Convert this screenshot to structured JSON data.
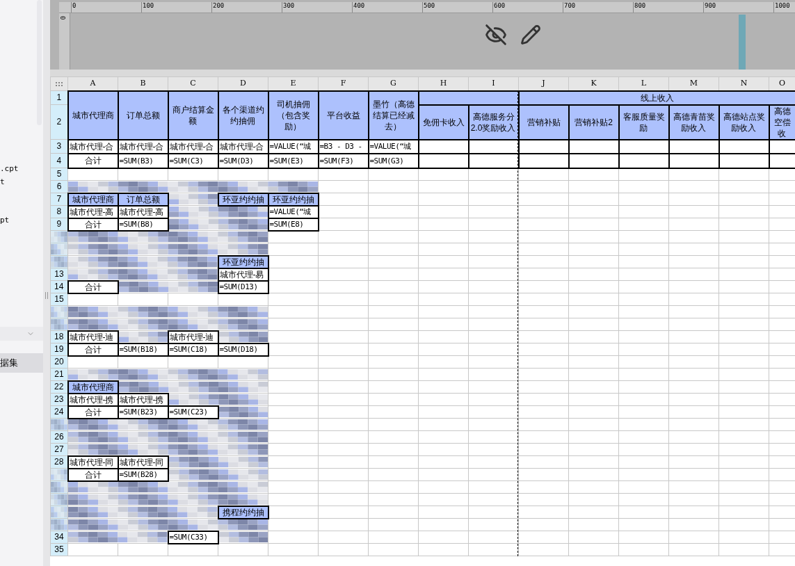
{
  "sidebar": {
    "files": [
      ".cpt",
      "t",
      "pt"
    ],
    "section_tab": "据集"
  },
  "ruler": {
    "top_labels": [
      "0",
      "100",
      "200",
      "300",
      "400",
      "500",
      "600",
      "700",
      "800",
      "900",
      "1000"
    ],
    "left_labels": [
      "0"
    ]
  },
  "columns": [
    "A",
    "B",
    "C",
    "D",
    "E",
    "F",
    "G",
    "H",
    "I",
    "J",
    "K",
    "L",
    "M",
    "N",
    "O"
  ],
  "rows": [
    {
      "number": "1",
      "cells": [
        {
          "kind": "tall-header",
          "text": "城市代理商"
        },
        {
          "kind": "tall-header",
          "text": "订单总额"
        },
        {
          "kind": "tall-header",
          "text": "商户结算金额"
        },
        {
          "kind": "tall-header",
          "text": "各个渠道约约抽佣"
        },
        {
          "kind": "tall-header",
          "text": "司机抽佣（包含奖励）"
        },
        {
          "kind": "tall-header",
          "text": "平台收益"
        },
        {
          "kind": "tall-header",
          "text": "墨竹（高德结算已经减去）"
        },
        {
          "kind": "group-header"
        },
        {
          "kind": "group-header",
          "text": "线上收入"
        }
      ]
    },
    {
      "number": "2",
      "cells": [
        {
          "kind": "header",
          "text": "免佣卡收入"
        },
        {
          "kind": "header",
          "text": "高德服务分2.0奖励收入"
        },
        {
          "kind": "header",
          "text": "营销补贴"
        },
        {
          "kind": "header",
          "text": "营销补贴2"
        },
        {
          "kind": "header",
          "text": "客服质量奖励"
        },
        {
          "kind": "header",
          "text": "高德青苗奖励收入"
        },
        {
          "kind": "header",
          "text": "高德站点奖励收入"
        },
        {
          "kind": "header",
          "text": "高德空偿收"
        }
      ]
    },
    {
      "number": "3",
      "cells": [
        {
          "kind": "data",
          "text": "城市代理-合"
        },
        {
          "kind": "data",
          "text": "城市代理-合"
        },
        {
          "kind": "data",
          "text": "城市代理-合"
        },
        {
          "kind": "data",
          "text": "城市代理-合"
        },
        {
          "kind": "formula",
          "text": "=VALUE(“城"
        },
        {
          "kind": "formula",
          "text": "=B3 - D3 -"
        },
        {
          "kind": "formula",
          "text": "=VALUE(“城"
        },
        {
          "kind": "blank"
        },
        {
          "kind": "blank"
        },
        {
          "kind": "blank"
        },
        {
          "kind": "blank"
        },
        {
          "kind": "blank"
        },
        {
          "kind": "blank"
        },
        {
          "kind": "blank"
        },
        {
          "kind": "blank"
        }
      ]
    },
    {
      "number": "4",
      "cells": [
        {
          "kind": "total",
          "text": "合计"
        },
        {
          "kind": "formula",
          "text": "=SUM(B3)"
        },
        {
          "kind": "formula",
          "text": "=SUM(C3)"
        },
        {
          "kind": "formula",
          "text": "=SUM(D3)"
        },
        {
          "kind": "formula",
          "text": "=SUM(E3)"
        },
        {
          "kind": "formula",
          "text": "=SUM(F3)"
        },
        {
          "kind": "formula",
          "text": "=SUM(G3)"
        },
        {
          "kind": "blank"
        },
        {
          "kind": "blank"
        },
        {
          "kind": "blank"
        },
        {
          "kind": "blank"
        },
        {
          "kind": "blank"
        },
        {
          "kind": "blank"
        },
        {
          "kind": "blank"
        },
        {
          "kind": "blank"
        }
      ]
    },
    {
      "number": "5",
      "cells": []
    },
    {
      "number": "6",
      "cells": [
        {
          "kind": "redacted"
        },
        {
          "kind": "redacted"
        },
        {
          "kind": "redacted"
        },
        {
          "kind": "redacted"
        },
        {
          "kind": "redacted"
        }
      ]
    },
    {
      "number": "7",
      "cells": [
        {
          "kind": "header",
          "text": "城市代理商"
        },
        {
          "kind": "header",
          "text": "订单总额"
        },
        {
          "kind": "redacted"
        },
        {
          "kind": "header",
          "text": "环亚约约抽"
        },
        {
          "kind": "header",
          "text": "环亚约约抽"
        }
      ]
    },
    {
      "number": "8",
      "cells": [
        {
          "kind": "data",
          "text": "城市代理-高"
        },
        {
          "kind": "data",
          "text": "城市代理-高"
        },
        {
          "kind": "redacted"
        },
        {
          "kind": "redacted"
        },
        {
          "kind": "formula",
          "text": "=VALUE(“城"
        }
      ]
    },
    {
      "number": "9",
      "cells": [
        {
          "kind": "total",
          "text": "合计"
        },
        {
          "kind": "formula",
          "text": "=SUM(B8)"
        },
        {
          "kind": "redacted"
        },
        {
          "kind": "redacted"
        },
        {
          "kind": "formula",
          "text": "=SUM(E8)"
        }
      ]
    },
    {
      "cells": [
        {
          "kind": "redacted"
        },
        {
          "kind": "redacted"
        },
        {
          "kind": "redacted"
        },
        {
          "kind": "redacted"
        }
      ]
    },
    {
      "cells": [
        {
          "kind": "redacted"
        },
        {
          "kind": "redacted"
        },
        {
          "kind": "redacted"
        },
        {
          "kind": "redacted"
        }
      ]
    },
    {
      "cells": [
        {
          "kind": "redacted"
        },
        {
          "kind": "redacted"
        },
        {
          "kind": "redacted"
        },
        {
          "kind": "header",
          "text": "环亚约约抽"
        }
      ]
    },
    {
      "number": "13",
      "cells": [
        {
          "kind": "redacted"
        },
        {
          "kind": "redacted"
        },
        {
          "kind": "redacted"
        },
        {
          "kind": "data",
          "text": "城市代理-易"
        }
      ]
    },
    {
      "number": "14",
      "cells": [
        {
          "kind": "total",
          "text": "合计"
        },
        {
          "kind": "redacted"
        },
        {
          "kind": "redacted"
        },
        {
          "kind": "formula",
          "text": "=SUM(D13)"
        }
      ]
    },
    {
      "number": "15",
      "cells": []
    },
    {
      "cells": [
        {
          "kind": "redacted"
        },
        {
          "kind": "redacted"
        },
        {
          "kind": "redacted"
        },
        {
          "kind": "redacted"
        }
      ]
    },
    {
      "cells": [
        {
          "kind": "redacted"
        },
        {
          "kind": "redacted"
        },
        {
          "kind": "redacted"
        },
        {
          "kind": "redacted"
        }
      ]
    },
    {
      "number": "18",
      "cells": [
        {
          "kind": "data",
          "text": "城市代理-迪"
        },
        {
          "kind": "redacted"
        },
        {
          "kind": "data",
          "text": "城市代理-迪"
        },
        {
          "kind": "redacted"
        }
      ]
    },
    {
      "number": "19",
      "cells": [
        {
          "kind": "total",
          "text": "合计"
        },
        {
          "kind": "formula",
          "text": "=SUM(B18)"
        },
        {
          "kind": "formula",
          "text": "=SUM(C18)"
        },
        {
          "kind": "formula",
          "text": "=SUM(D18)"
        }
      ]
    },
    {
      "number": "20",
      "cells": []
    },
    {
      "number": "21",
      "cells": [
        {
          "kind": "redacted"
        },
        {
          "kind": "redacted"
        },
        {
          "kind": "redacted"
        },
        {
          "kind": "redacted"
        }
      ]
    },
    {
      "number": "22",
      "cells": [
        {
          "kind": "header",
          "text": "城市代理商"
        },
        {
          "kind": "redacted"
        },
        {
          "kind": "redacted"
        },
        {
          "kind": "redacted"
        }
      ]
    },
    {
      "number": "23",
      "cells": [
        {
          "kind": "data",
          "text": "城市代理-携"
        },
        {
          "kind": "data",
          "text": "城市代理-携"
        },
        {
          "kind": "redacted"
        },
        {
          "kind": "redacted"
        }
      ]
    },
    {
      "number": "24",
      "cells": [
        {
          "kind": "total",
          "text": "合计"
        },
        {
          "kind": "formula",
          "text": "=SUM(B23)"
        },
        {
          "kind": "formula",
          "text": "=SUM(C23)"
        },
        {
          "kind": "redacted"
        }
      ]
    },
    {
      "cells": [
        {
          "kind": "redacted"
        },
        {
          "kind": "redacted"
        },
        {
          "kind": "redacted"
        },
        {
          "kind": "redacted"
        }
      ]
    },
    {
      "number": "26",
      "cells": [
        {
          "kind": "redacted"
        },
        {
          "kind": "redacted"
        },
        {
          "kind": "redacted"
        },
        {
          "kind": "redacted"
        }
      ]
    },
    {
      "number": "27",
      "cells": [
        {
          "kind": "redacted"
        },
        {
          "kind": "redacted"
        },
        {
          "kind": "redacted"
        },
        {
          "kind": "redacted"
        }
      ]
    },
    {
      "number": "28",
      "cells": [
        {
          "kind": "data",
          "text": "城市代理-同"
        },
        {
          "kind": "data",
          "text": "城市代理-同"
        },
        {
          "kind": "redacted"
        },
        {
          "kind": "redacted"
        }
      ]
    },
    {
      "cells": [
        {
          "kind": "total",
          "text": "合计"
        },
        {
          "kind": "formula",
          "text": "=SUM(B28)"
        },
        {
          "kind": "redacted"
        },
        {
          "kind": "redacted"
        }
      ]
    },
    {
      "cells": [
        {
          "kind": "redacted"
        },
        {
          "kind": "redacted"
        },
        {
          "kind": "redacted"
        },
        {
          "kind": "redacted"
        }
      ]
    },
    {
      "cells": [
        {
          "kind": "redacted"
        },
        {
          "kind": "redacted"
        },
        {
          "kind": "redacted"
        },
        {
          "kind": "redacted"
        }
      ]
    },
    {
      "cells": [
        {
          "kind": "redacted"
        },
        {
          "kind": "redacted"
        },
        {
          "kind": "redacted"
        },
        {
          "kind": "header",
          "text": "携程约约抽"
        }
      ]
    },
    {
      "cells": [
        {
          "kind": "redacted"
        },
        {
          "kind": "redacted"
        },
        {
          "kind": "redacted"
        },
        {
          "kind": "redacted"
        }
      ]
    },
    {
      "number": "34",
      "cells": [
        {
          "kind": "redacted"
        },
        {
          "kind": "redacted"
        },
        {
          "kind": "formula",
          "text": "=SUM(C33)"
        },
        {
          "kind": "redacted"
        }
      ]
    },
    {
      "number": "35",
      "cells": []
    }
  ]
}
